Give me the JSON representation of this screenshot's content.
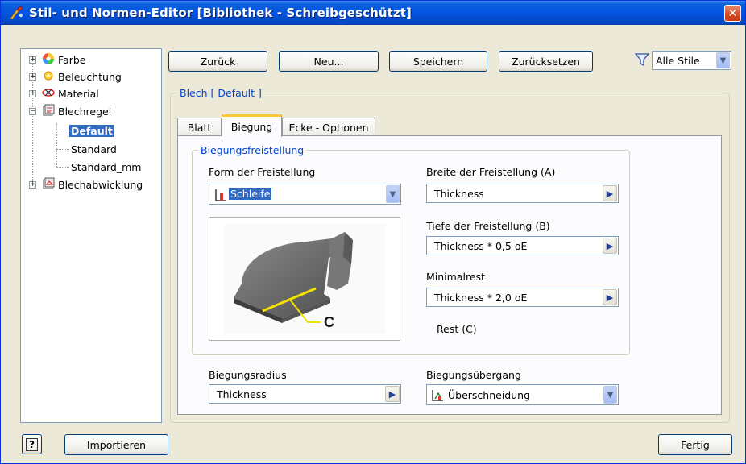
{
  "window": {
    "title": "Stil- und Normen-Editor [Bibliothek - Schreibgeschützt]",
    "close_icon": "close-icon"
  },
  "tree": {
    "items": [
      {
        "label": "Farbe",
        "icon": "color-wheel-icon"
      },
      {
        "label": "Beleuchtung",
        "icon": "light-bulb-icon"
      },
      {
        "label": "Material",
        "icon": "material-icon"
      },
      {
        "label": "Blechregel",
        "icon": "sheet-rule-icon"
      },
      {
        "label": "Default",
        "selected": true
      },
      {
        "label": "Standard"
      },
      {
        "label": "Standard_mm"
      },
      {
        "label": "Blechabwicklung",
        "icon": "flat-pattern-icon"
      }
    ]
  },
  "toolbar": {
    "back": "Zurück",
    "new": "Neu...",
    "save": "Speichern",
    "reset": "Zurücksetzen",
    "filter_value": "Alle Stile"
  },
  "panel": {
    "title": "Blech [ Default ]"
  },
  "tabs": [
    {
      "label": "Blatt",
      "active": false
    },
    {
      "label": "Biegung",
      "active": true
    },
    {
      "label": "Ecke - Optionen",
      "active": false
    }
  ],
  "relief": {
    "group_title": "Biegungsfreistellung",
    "shape_label": "Form der Freistellung",
    "shape_value": "Schleife",
    "width_label": "Breite der Freistellung (A)",
    "width_value": "Thickness",
    "depth_label": "Tiefe der Freistellung (B)",
    "depth_value": "Thickness * 0,5 oE",
    "remnant_label": "Minimalrest",
    "remnant_value": "Thickness * 2,0 oE",
    "rest_note": "Rest  (C)",
    "callout_letter": "C"
  },
  "bend": {
    "radius_label": "Biegungsradius",
    "radius_value": "Thickness",
    "transition_label": "Biegungsübergang",
    "transition_value": "Überschneidung"
  },
  "footer": {
    "help": "?",
    "import": "Importieren",
    "done": "Fertig"
  },
  "colors": {
    "accent_blue": "#0046d5",
    "selection": "#316ac5",
    "tab_highlight": "#ffc83c",
    "callout_yellow": "#f2e400"
  }
}
